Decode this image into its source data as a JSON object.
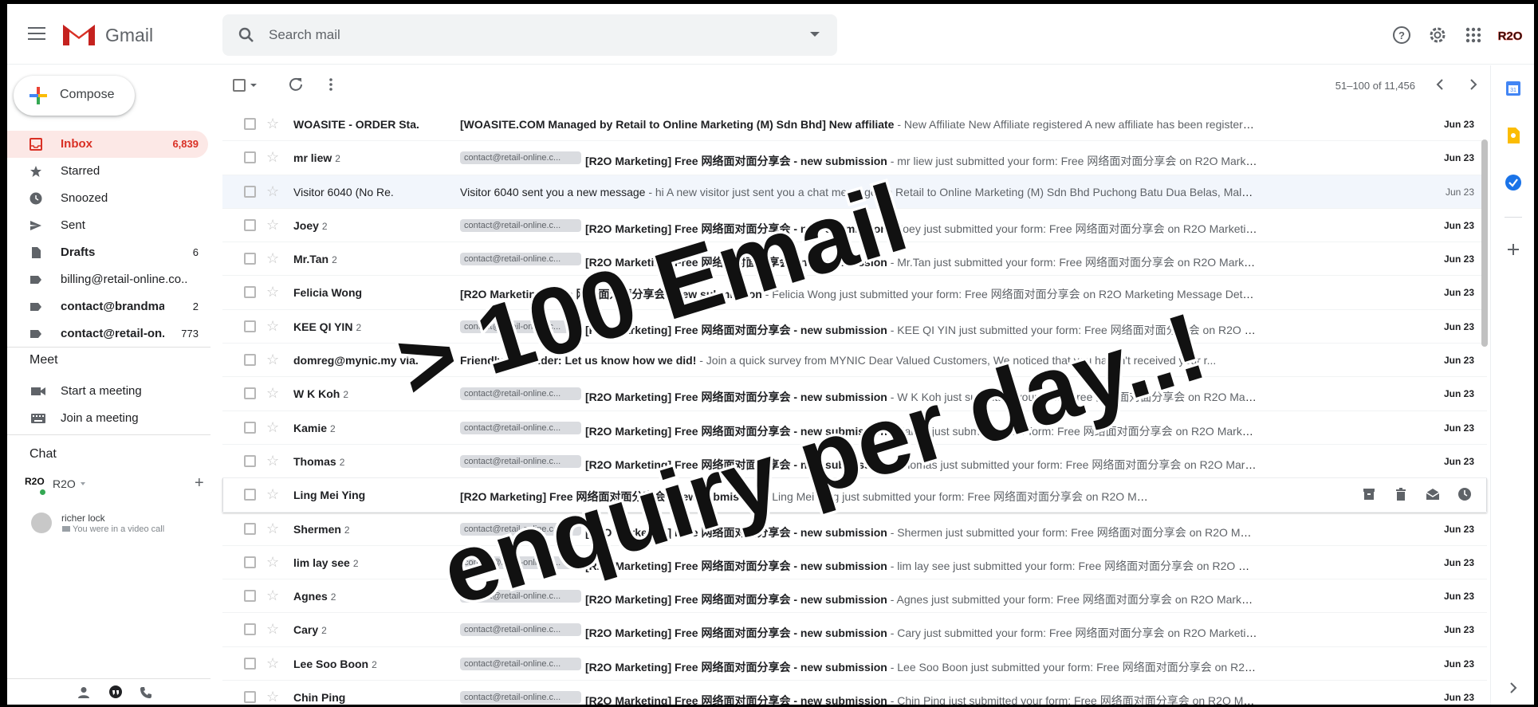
{
  "app": {
    "name": "Gmail"
  },
  "search": {
    "placeholder": "Search mail"
  },
  "account": {
    "avatar_text": "R2O"
  },
  "compose": {
    "label": "Compose"
  },
  "nav": {
    "items": [
      {
        "label": "Inbox",
        "count": "6,839",
        "icon": "inbox-icon"
      },
      {
        "label": "Starred",
        "count": "",
        "icon": "star-icon"
      },
      {
        "label": "Snoozed",
        "count": "",
        "icon": "clock-icon"
      },
      {
        "label": "Sent",
        "count": "",
        "icon": "send-icon"
      },
      {
        "label": "Drafts",
        "count": "6",
        "icon": "draft-icon"
      },
      {
        "label": "billing@retail-online.co...",
        "count": "",
        "icon": "label-icon"
      },
      {
        "label": "contact@brandmak...",
        "count": "2",
        "icon": "label-icon"
      },
      {
        "label": "contact@retail-on...",
        "count": "773",
        "icon": "label-icon"
      }
    ]
  },
  "meet": {
    "title": "Meet",
    "start": "Start a meeting",
    "join": "Join a meeting"
  },
  "chat": {
    "title": "Chat",
    "user": "R2O",
    "contact_name": "richer lock",
    "contact_status": "You were in a video call"
  },
  "toolbar": {
    "pagination": "51–100 of 11,456"
  },
  "chip_text": "contact@retail-online.c...",
  "emails": [
    {
      "sender": "WOASITE - ORDER Sta.",
      "count": "",
      "chip": false,
      "subject": "[WOASITE.COM Managed by Retail to Online Marketing (M) Sdn Bhd] New affiliate",
      "snippet": " - New Affiliate New Affiliate registered A new affiliate has been registered for user KarlC...",
      "date": "Jun 23",
      "unread": true
    },
    {
      "sender": "mr liew",
      "count": "2",
      "chip": true,
      "subject": "[R2O Marketing] Free 网络面对面分享会 - new submission",
      "snippet": " - mr liew just submitted your form: Free 网络面对面分享会 on R2O Marketing Message D...",
      "date": "Jun 23",
      "unread": true
    },
    {
      "sender": "Visitor 6040 (No Re.",
      "count": "",
      "chip": false,
      "subject": "Visitor 6040 sent you a new message",
      "snippet": " - hi A new visitor just sent you a chat message on Retail to Online Marketing (M) Sdn Bhd Puchong Batu Dua Belas, Malaysia Puchong...",
      "date": "Jun 23",
      "unread": false
    },
    {
      "sender": "Joey",
      "count": "2",
      "chip": true,
      "subject": "[R2O Marketing] Free 网络面对面分享会 - new submission",
      "snippet": " - Joey just submitted your form: Free 网络面对面分享会 on R2O Marketing Message Deta...",
      "date": "Jun 23",
      "unread": true
    },
    {
      "sender": "Mr.Tan",
      "count": "2",
      "chip": true,
      "subject": "[R2O Marketing] Free 网络面对面分享会 - new submission",
      "snippet": " - Mr.Tan just submitted your form: Free 网络面对面分享会 on R2O Marketing Message De...",
      "date": "Jun 23",
      "unread": true
    },
    {
      "sender": "Felicia Wong",
      "count": "",
      "chip": false,
      "subject": "[R2O Marketing] Free 网络面对面分享会 - new submission",
      "snippet": " - Felicia Wong just submitted your form: Free 网络面对面分享会 on R2O Marketing Message Details: 姓名: Felicia...",
      "date": "Jun 23",
      "unread": true
    },
    {
      "sender": "KEE QI YIN",
      "count": "2",
      "chip": true,
      "subject": "[R2O Marketing] Free 网络面对面分享会 - new submission",
      "snippet": " - KEE QI YIN just submitted your form: Free 网络面对面分享会 on R2O Marketing Messag...",
      "date": "Jun 23",
      "unread": true
    },
    {
      "sender": "domreg@mynic.my via.",
      "count": "",
      "chip": false,
      "subject": "Friendly Reminder: Let us know how we did!",
      "snippet": " - Join a quick survey from MYNIC Dear Valued Customers, We noticed that you haven't received your r...",
      "date": "Jun 23",
      "unread": true
    },
    {
      "sender": "W K Koh",
      "count": "2",
      "chip": true,
      "subject": "[R2O Marketing] Free 网络面对面分享会 - new submission",
      "snippet": " - W K Koh just submitted your form: Free 网络面对面分享会 on R2O Marketing Message D...",
      "date": "Jun 23",
      "unread": true
    },
    {
      "sender": "Kamie",
      "count": "2",
      "chip": true,
      "subject": "[R2O Marketing] Free 网络面对面分享会 - new submission",
      "snippet": " - Kamie just submitted your form: Free 网络面对面分享会 on R2O Marketing Message Det...",
      "date": "Jun 23",
      "unread": true
    },
    {
      "sender": "Thomas",
      "count": "2",
      "chip": true,
      "subject": "[R2O Marketing] Free 网络面对面分享会 - new submission",
      "snippet": " - Thomas just submitted your form: Free 网络面对面分享会 on R2O Marketing Message D...",
      "date": "Jun 23",
      "unread": true
    },
    {
      "sender": "Ling Mei Ying",
      "count": "",
      "chip": false,
      "subject": "[R2O Marketing] Free 网络面对面分享会 - new submission",
      "snippet": " - Ling Mei Ying just submitted your form: Free 网络面对面分享会 on R2O Marketing Message Details: ...",
      "date": "",
      "unread": true,
      "hover": true
    },
    {
      "sender": "Shermen",
      "count": "2",
      "chip": true,
      "subject": "[R2O Marketing] Free 网络面对面分享会 - new submission",
      "snippet": " - Shermen just submitted your form: Free 网络面对面分享会 on R2O Marketing Message ...",
      "date": "Jun 23",
      "unread": true
    },
    {
      "sender": "lim lay see",
      "count": "2",
      "chip": true,
      "subject": "[R2O Marketing] Free 网络面对面分享会 - new submission",
      "snippet": " - lim lay see just submitted your form: Free 网络面对面分享会 on R2O Marketing Messag...",
      "date": "Jun 23",
      "unread": true
    },
    {
      "sender": "Agnes",
      "count": "2",
      "chip": true,
      "subject": "[R2O Marketing] Free 网络面对面分享会 - new submission",
      "snippet": " - Agnes just submitted your form: Free 网络面对面分享会 on R2O Marketing Message Det...",
      "date": "Jun 23",
      "unread": true
    },
    {
      "sender": "Cary",
      "count": "2",
      "chip": true,
      "subject": "[R2O Marketing] Free 网络面对面分享会 - new submission",
      "snippet": " - Cary just submitted your form: Free 网络面对面分享会 on R2O Marketing Message Detai...",
      "date": "Jun 23",
      "unread": true
    },
    {
      "sender": "Lee Soo Boon",
      "count": "2",
      "chip": true,
      "subject": "[R2O Marketing] Free 网络面对面分享会 - new submission",
      "snippet": " - Lee Soo Boon just submitted your form: Free 网络面对面分享会 on R2O Marketing Mess...",
      "date": "Jun 23",
      "unread": true
    },
    {
      "sender": "Chin Ping",
      "count": "",
      "chip": true,
      "subject": "[R2O Marketing] Free 网络面对面分享会 - new submission",
      "snippet": " - Chin Ping just submitted your form: Free 网络面对面分享会 on R2O Marketing Message ...",
      "date": "Jun 23",
      "unread": true
    }
  ],
  "overlay": {
    "line1": "> 100 Email",
    "line2": "enquiry per day..!"
  },
  "colors": {
    "accent": "#d93025",
    "inbox_bg": "#fce8e6",
    "blue": "#1a73e8"
  }
}
